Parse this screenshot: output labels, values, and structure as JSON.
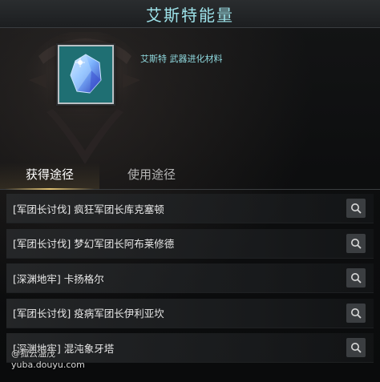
{
  "window": {
    "title": "艾斯特能量"
  },
  "item": {
    "subtitle": "艾斯特 武器进化材料",
    "icon": "blue-crystal-icon"
  },
  "tabs": [
    {
      "label": "获得途径",
      "active": true
    },
    {
      "label": "使用途径",
      "active": false
    }
  ],
  "sources": [
    {
      "label": "[军团长讨伐] 疯狂军团长库克塞顿"
    },
    {
      "label": "[军团长讨伐] 梦幻军团长阿布莱修德"
    },
    {
      "label": "[深渊地牢] 卡扬格尔"
    },
    {
      "label": "[军团长讨伐] 疫病军团长伊利亚坎"
    },
    {
      "label": "[深渊地牢] 混沌象牙塔"
    }
  ],
  "watermark": {
    "line1": "@孤云温茂",
    "line2": "yuba.douyu.com"
  },
  "colors": {
    "title": "#9ee3ea",
    "tab_underline": "#e3c373",
    "item_bg": "#1f6f73"
  }
}
